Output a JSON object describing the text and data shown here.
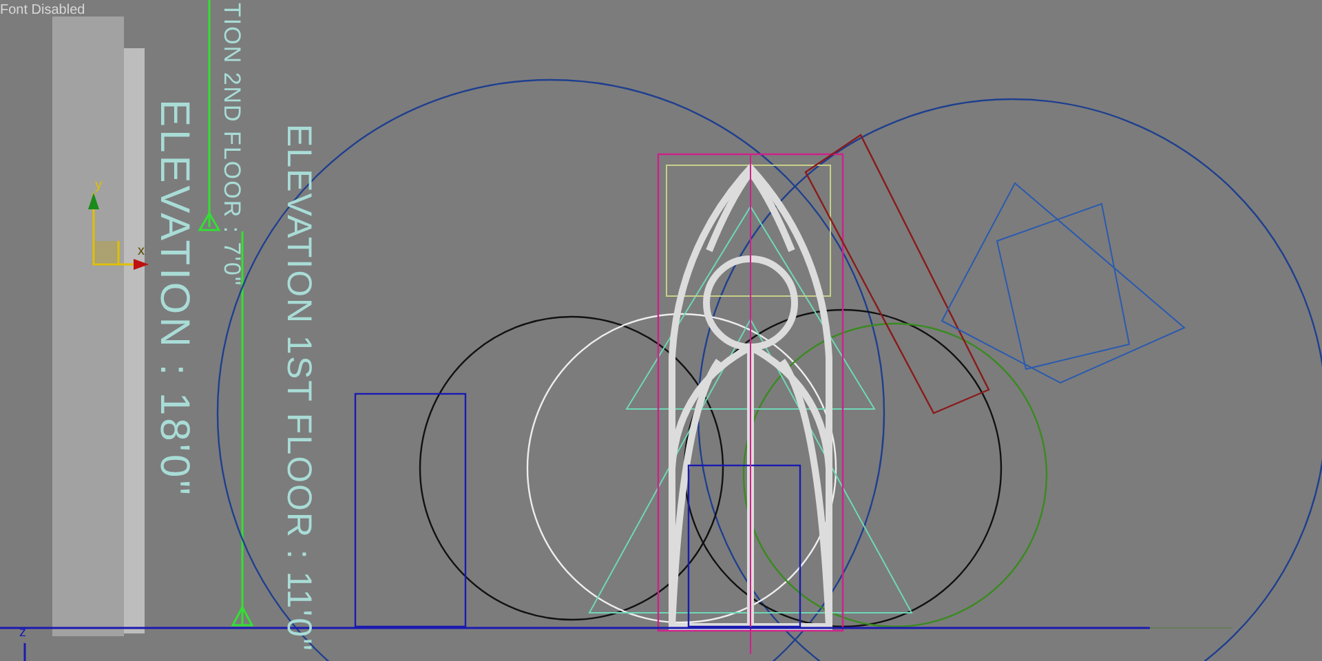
{
  "viewport": {
    "status_text": "Font Disabled",
    "labels": [
      {
        "text": "TION 2ND FLOOR : 7'0\"",
        "kind": "small"
      },
      {
        "text": "ELEVATION : 18'0\"",
        "kind": "large"
      },
      {
        "text": "ELEVATION 1ST FLOOR : 11'0\"",
        "kind": "medium"
      }
    ],
    "axis_labels": [
      "y",
      "x",
      "z"
    ]
  }
}
